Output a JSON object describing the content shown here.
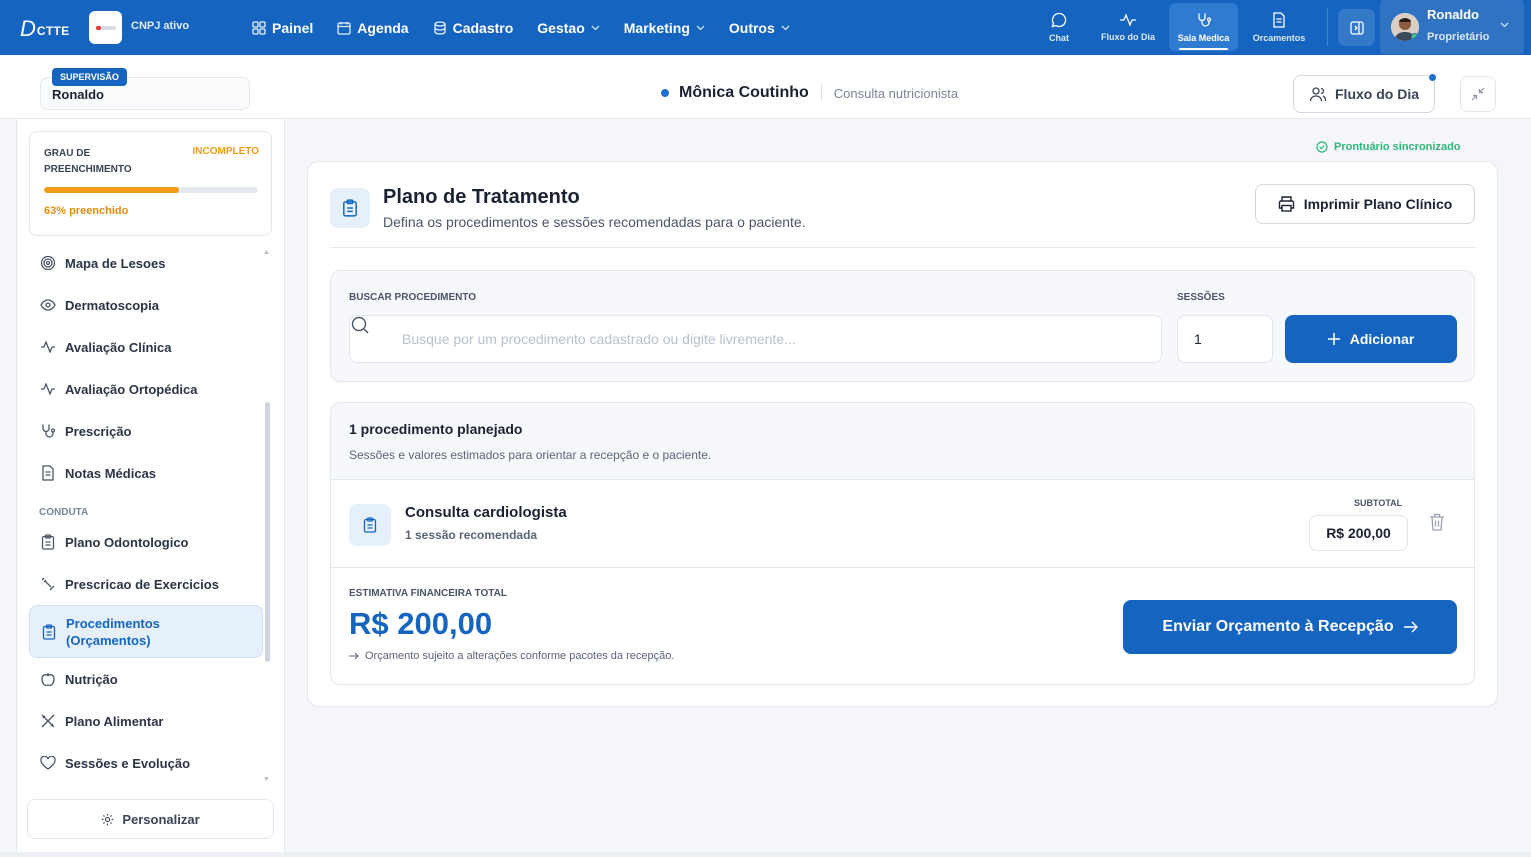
{
  "topnav": {
    "logo_letter": "D",
    "logo_rest": "CTTE",
    "cnpj_status": "CNPJ ativo",
    "menu": [
      {
        "label": "Painel",
        "icon": "grid-icon"
      },
      {
        "label": "Agenda",
        "icon": "calendar-icon"
      },
      {
        "label": "Cadastro",
        "icon": "database-icon"
      },
      {
        "label": "Gestao",
        "icon": "chevron-down-icon"
      },
      {
        "label": "Marketing",
        "icon": "chevron-down-icon"
      },
      {
        "label": "Outros",
        "icon": "chevron-down-icon"
      }
    ],
    "quick_actions": [
      {
        "label": "Chat",
        "icon": "chat-icon"
      },
      {
        "label": "Fluxo do Dia",
        "icon": "pulse-icon"
      },
      {
        "label": "Sala Medica",
        "icon": "stethoscope-icon",
        "active": true
      },
      {
        "label": "Orcamentos",
        "icon": "document-icon"
      }
    ],
    "user": {
      "name": "Ronaldo",
      "role": "Proprietário"
    },
    "colors": {
      "primary": "#1565c0",
      "active_tab": "#2f7bd2"
    }
  },
  "subheader": {
    "supervision_badge": "SUPERVISÃO",
    "supervisor_name": "Ronaldo",
    "patient_name": "Mônica Coutinho",
    "consultation_type": "Consulta nutricionista",
    "fluxo_button": "Fluxo do Dia"
  },
  "sidebar": {
    "progress": {
      "label": "GRAU DE PREENCHIMENTO",
      "status": "INCOMPLETO",
      "percent": 63,
      "text": "63% preenchido",
      "color": "#f29b1a"
    },
    "items": [
      {
        "label": "Mapa de Lesoes",
        "icon": "target-icon"
      },
      {
        "label": "Dermatoscopia",
        "icon": "eye-icon"
      },
      {
        "label": "Avaliação Clínica",
        "icon": "pulse-icon"
      },
      {
        "label": "Avaliação Ortopédica",
        "icon": "pulse-icon"
      },
      {
        "label": "Prescrição",
        "icon": "stethoscope-icon"
      },
      {
        "label": "Notas Médicas",
        "icon": "document-icon"
      }
    ],
    "section_conduta": "CONDUTA",
    "conduta_items": [
      {
        "label": "Plano Odontologico",
        "icon": "clipboard-icon"
      },
      {
        "label": "Prescricao de Exercicios",
        "icon": "dumbbell-icon"
      },
      {
        "label": "Procedimentos",
        "label2": "(Orçamentos)",
        "icon": "clipboard-icon",
        "active": true
      },
      {
        "label": "Nutrição",
        "icon": "apple-icon"
      },
      {
        "label": "Plano Alimentar",
        "icon": "utensils-icon"
      },
      {
        "label": "Sessões e Evolução",
        "icon": "heart-icon"
      }
    ],
    "personalize_button": "Personalizar"
  },
  "main": {
    "sync_status": "Prontuário sincronizado",
    "title": "Plano de Tratamento",
    "subtitle": "Defina os procedimentos e sessões recomendadas para o paciente.",
    "print_button": "Imprimir Plano Clínico",
    "search": {
      "label": "BUSCAR PROCEDIMENTO",
      "placeholder": "Busque por um procedimento cadastrado ou digite livremente...",
      "value": ""
    },
    "sessions": {
      "label": "SESSÕES",
      "value": "1"
    },
    "add_button": "Adicionar",
    "procedures": {
      "count_text": "1 procedimento planejado",
      "description": "Sessões e valores estimados para orientar a recepção e o paciente.",
      "rows": [
        {
          "name": "Consulta cardiologista",
          "sessions_text": "1 sessão recomendada",
          "subtotal_label": "SUBTOTAL",
          "subtotal": "R$ 200,00"
        }
      ]
    },
    "estimate": {
      "label": "ESTIMATIVA FINANCEIRA TOTAL",
      "value": "R$ 200,00",
      "note": "Orçamento sujeito a alterações conforme pacotes da recepção."
    },
    "send_button": "Enviar Orçamento à Recepção"
  }
}
